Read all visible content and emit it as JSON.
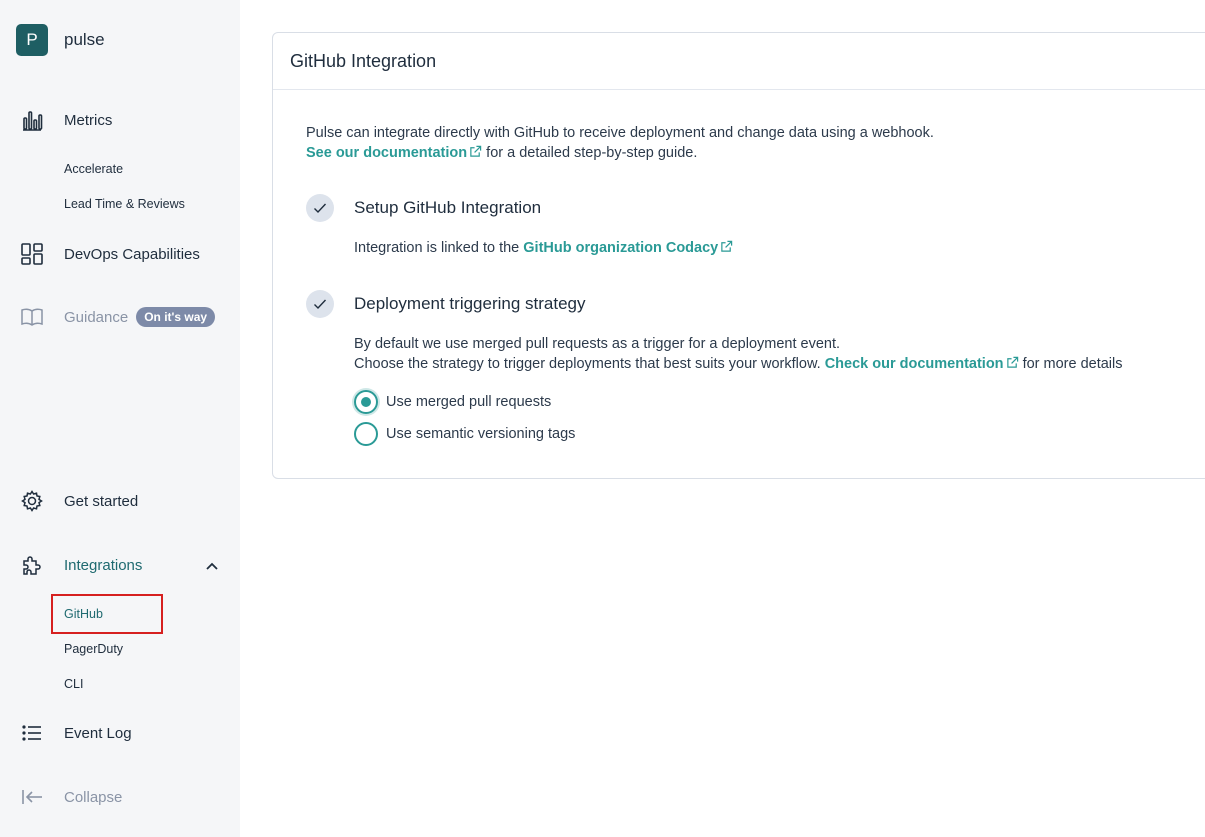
{
  "brand": {
    "logo_letter": "P",
    "name": "pulse"
  },
  "sidebar": {
    "metrics": {
      "label": "Metrics",
      "icon": "bar-chart-icon"
    },
    "metrics_sub": [
      "Accelerate",
      "Lead Time & Reviews"
    ],
    "devops": {
      "label": "DevOps Capabilities",
      "icon": "grid-icon"
    },
    "guidance": {
      "label": "Guidance",
      "badge": "On it's way",
      "icon": "book-icon"
    },
    "get_started": {
      "label": "Get started",
      "icon": "gear-icon"
    },
    "integrations": {
      "label": "Integrations",
      "icon": "puzzle-icon"
    },
    "integrations_sub": [
      "GitHub",
      "PagerDuty",
      "CLI"
    ],
    "event_log": {
      "label": "Event Log",
      "icon": "list-icon"
    },
    "collapse": {
      "label": "Collapse",
      "icon": "collapse-left-icon"
    }
  },
  "card": {
    "title": "GitHub Integration",
    "intro_line1": "Pulse can integrate directly with GitHub to receive deployment and change data using a webhook.",
    "intro_link": "See our documentation",
    "intro_line2_rest": " for a detailed step-by-step guide.",
    "step1": {
      "title": "Setup GitHub Integration",
      "body_prefix": "Integration is linked to the ",
      "body_link": "GitHub organization Codacy"
    },
    "step2": {
      "title": "Deployment triggering strategy",
      "line1": "By default we use merged pull requests as a trigger for a deployment event.",
      "line2_prefix": "Choose the strategy to trigger deployments that best suits your workflow. ",
      "line2_link": "Check our documentation",
      "line2_suffix": " for more details",
      "options": [
        {
          "label": "Use merged pull requests",
          "selected": true
        },
        {
          "label": "Use semantic versioning tags",
          "selected": false
        }
      ]
    }
  },
  "colors": {
    "accent": "#2a9a96",
    "brand": "#1e5e63",
    "highlight": "#d62020"
  }
}
